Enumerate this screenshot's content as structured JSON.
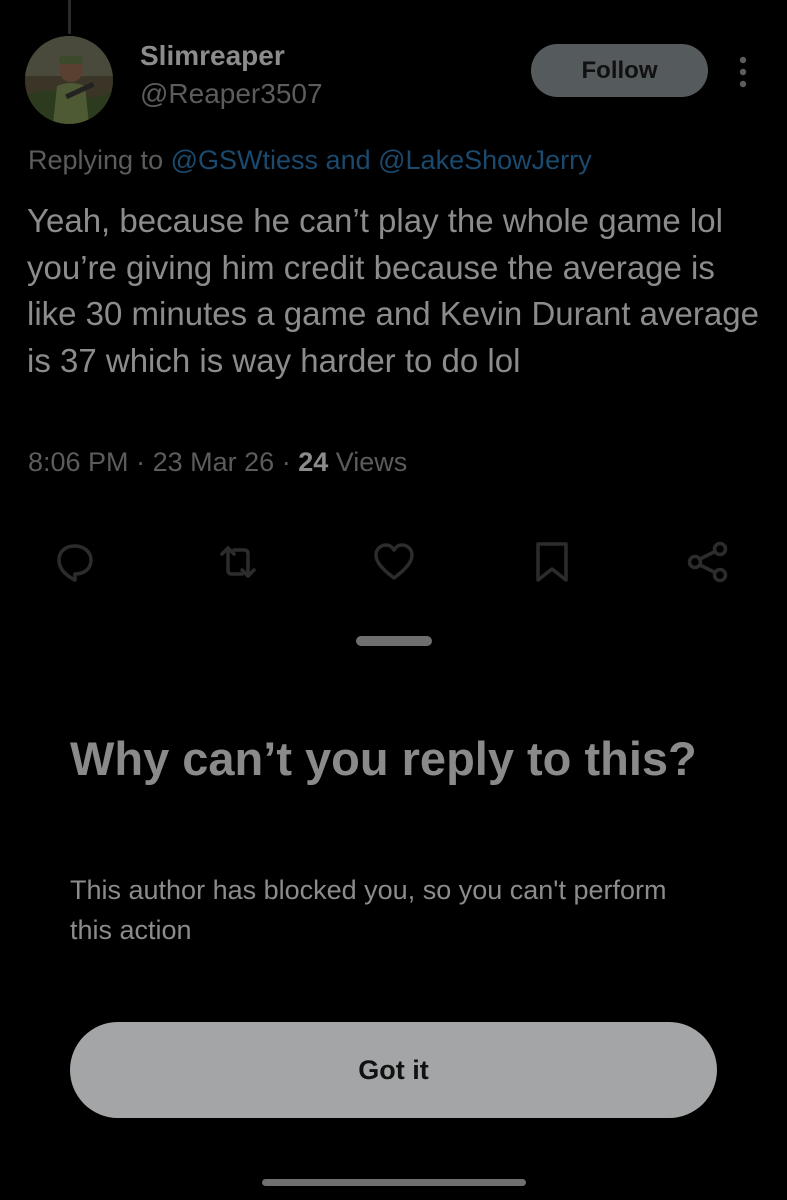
{
  "post": {
    "author": {
      "display_name": "Slimreaper",
      "handle": "@Reaper3507",
      "avatar_icon": "profile-photo-soldier"
    },
    "follow_label": "Follow",
    "more_icon": "more-vertical-icon",
    "replying_prefix": "Replying to",
    "replying_to": {
      "first": "@GSWtiess",
      "connector": "and",
      "second": "@LakeShowJerry"
    },
    "text": "Yeah, because he can’t play the whole game lol you’re giving him credit because the average is like 30 minutes a game and Kevin Durant average is 37 which is way harder to do lol",
    "meta": {
      "time": "8:06 PM",
      "separator": "·",
      "date": "23 Mar 26",
      "views_count": "24",
      "views_label": "Views"
    },
    "actions": [
      {
        "name": "reply",
        "icon": "comment-icon"
      },
      {
        "name": "repost",
        "icon": "repost-icon"
      },
      {
        "name": "like",
        "icon": "heart-icon"
      },
      {
        "name": "bookmark",
        "icon": "bookmark-icon"
      },
      {
        "name": "share",
        "icon": "share-icon"
      }
    ]
  },
  "sheet": {
    "title": "Why can’t you reply to this?",
    "body": "This author has blocked you, so you can't perform this action",
    "button_label": "Got it"
  },
  "colors": {
    "background": "#000000",
    "primary_text": "#8c8c8c",
    "secondary_text": "#5c5c5c",
    "link": "#1b4a6e",
    "follow_button": "#555a5d",
    "got_it_button": "#a3a5a6"
  }
}
